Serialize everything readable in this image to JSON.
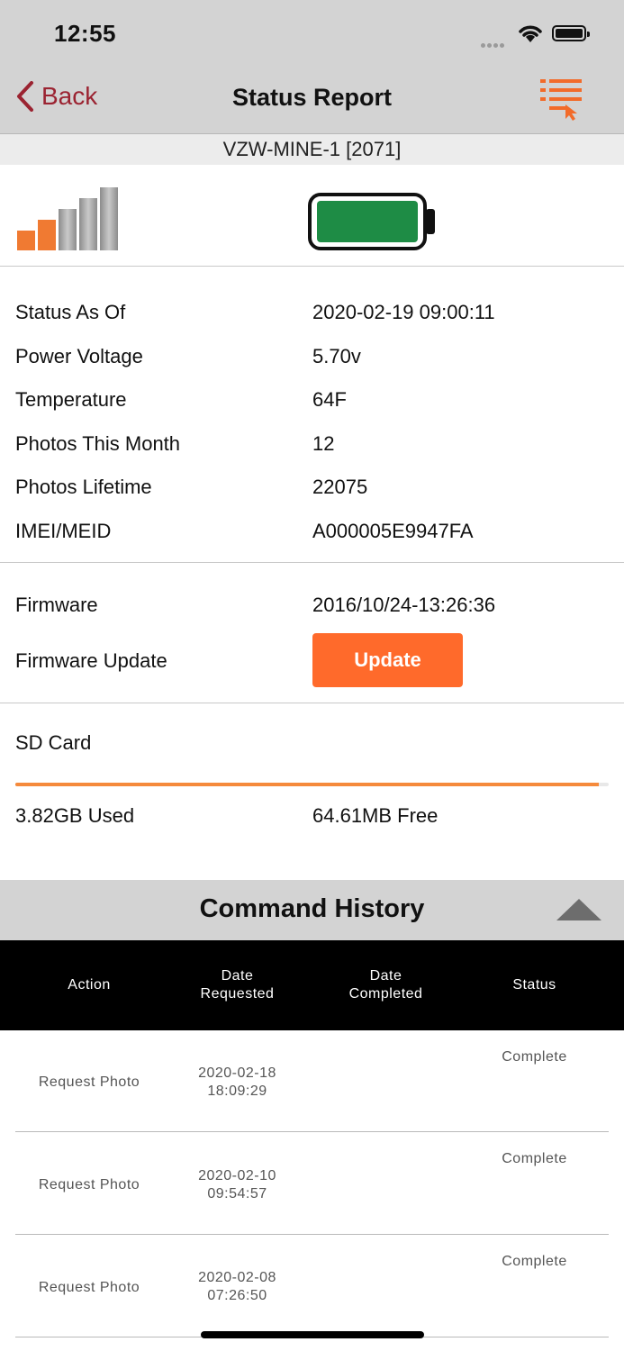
{
  "status_bar": {
    "time": "12:55"
  },
  "nav": {
    "back_label": "Back",
    "title": "Status Report",
    "menu_icon": "list-select-icon"
  },
  "device": {
    "name": "VZW-MINE-1  [2071]"
  },
  "signal": {
    "bars_active": 2,
    "bars_total": 5,
    "icon": "signal-bars-icon"
  },
  "battery": {
    "icon": "battery-full-icon",
    "color": "#1e8c45"
  },
  "status": [
    {
      "label": "Status As Of",
      "value": "2020-02-19 09:00:11"
    },
    {
      "label": "Power Voltage",
      "value": "5.70v"
    },
    {
      "label": "Temperature",
      "value": "64F"
    },
    {
      "label": "Photos This Month",
      "value": "12"
    },
    {
      "label": "Photos Lifetime",
      "value": "22075"
    },
    {
      "label": "IMEI/MEID",
      "value": "A000005E9947FA"
    }
  ],
  "firmware": {
    "label": "Firmware",
    "value": "2016/10/24-13:26:36",
    "update_label": "Firmware Update",
    "update_button": "Update"
  },
  "sd_card": {
    "label": "SD Card",
    "used": "3.82GB Used",
    "free": "64.61MB Free",
    "used_fraction": 0.983
  },
  "command_history": {
    "title": "Command History",
    "headers": [
      "Action",
      "Date\nRequested",
      "Date\nCompleted",
      "Status"
    ],
    "rows": [
      {
        "action": "Request Photo",
        "requested": "2020-02-18\n18:09:29",
        "completed": "",
        "status": "Complete"
      },
      {
        "action": "Request Photo",
        "requested": "2020-02-10\n09:54:57",
        "completed": "",
        "status": "Complete"
      },
      {
        "action": "Request Photo",
        "requested": "2020-02-08\n07:26:50",
        "completed": "",
        "status": "Complete"
      }
    ]
  },
  "colors": {
    "accent": "#ff6a2b",
    "back": "#9b2331",
    "sd_fill": "#f58a3c"
  }
}
